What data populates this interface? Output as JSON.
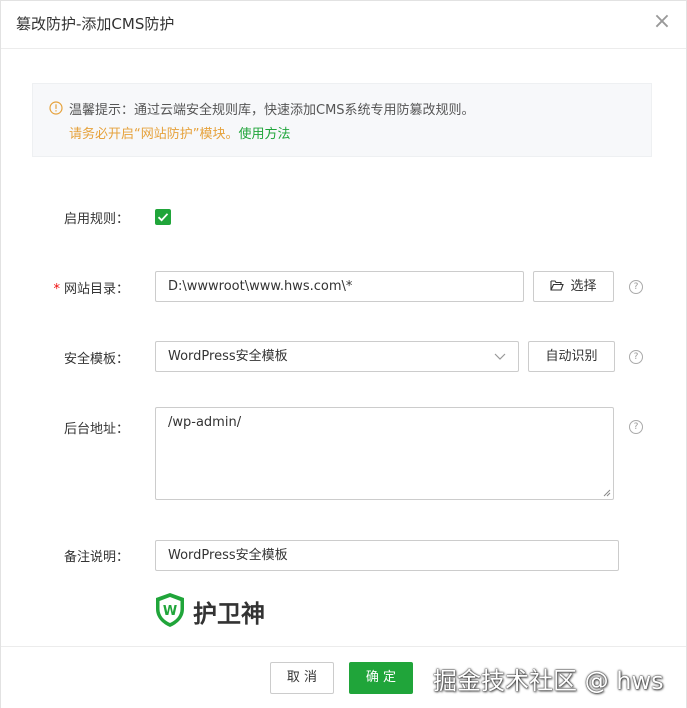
{
  "dialog": {
    "title": "篡改防护-添加CMS防护",
    "close_icon": "×"
  },
  "tip": {
    "line1": "温馨提示：通过云端安全规则库，快速添加CMS系统专用防篡改规则。",
    "line2_warning": "请务必开启“网站防护”模块。",
    "line2_link": "使用方法",
    "warning_color": "#e6a23c",
    "link_color": "#20a53a"
  },
  "form": {
    "enable_label": "启用规则：",
    "enable_checked": true,
    "site_dir_label": "网站目录：",
    "site_dir_required": "*",
    "site_dir_value": "D:\\wwwroot\\www.hws.com\\*",
    "select_button": "选择",
    "template_label": "安全模板：",
    "template_value": "WordPress安全模板",
    "auto_detect_button": "自动识别",
    "admin_label": "后台地址：",
    "admin_value": "/wp-admin/",
    "remark_label": "备注说明：",
    "remark_value": "WordPress安全模板",
    "help_icon": "?"
  },
  "brand": {
    "text": "护卫神",
    "logo_letter": "W",
    "logo_color": "#20a53a"
  },
  "footer": {
    "cancel": "取 消",
    "confirm": "确 定",
    "watermark": "掘金技术社区 @ hws"
  },
  "colors": {
    "accent": "#20a53a",
    "required": "#ef0808"
  }
}
